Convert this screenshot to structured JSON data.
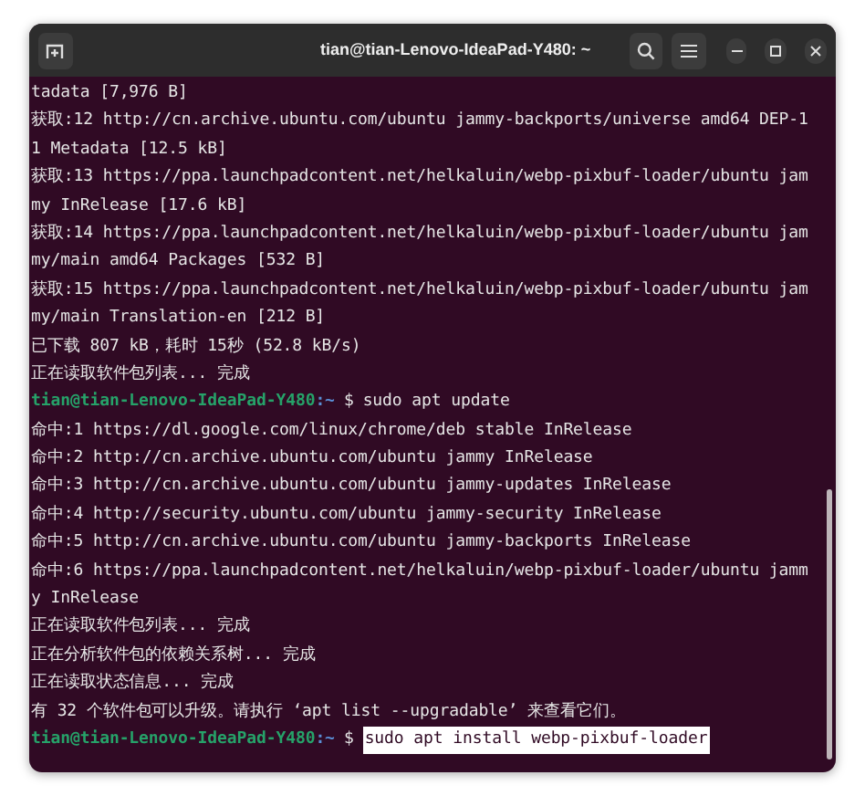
{
  "window": {
    "title": "tian@tian-Lenovo-IdeaPad-Y480: ~"
  },
  "lines": [
    {
      "kind": "output",
      "text": "tadata [7,976 B]"
    },
    {
      "kind": "output",
      "text": "获取:12 http://cn.archive.ubuntu.com/ubuntu jammy-backports/universe amd64 DEP-1"
    },
    {
      "kind": "output",
      "text": "1 Metadata [12.5 kB]"
    },
    {
      "kind": "output",
      "text": "获取:13 https://ppa.launchpadcontent.net/helkaluin/webp-pixbuf-loader/ubuntu jam"
    },
    {
      "kind": "output",
      "text": "my InRelease [17.6 kB]"
    },
    {
      "kind": "output",
      "text": "获取:14 https://ppa.launchpadcontent.net/helkaluin/webp-pixbuf-loader/ubuntu jam"
    },
    {
      "kind": "output",
      "text": "my/main amd64 Packages [532 B]"
    },
    {
      "kind": "output",
      "text": "获取:15 https://ppa.launchpadcontent.net/helkaluin/webp-pixbuf-loader/ubuntu jam"
    },
    {
      "kind": "output",
      "text": "my/main Translation-en [212 B]"
    },
    {
      "kind": "output",
      "text": "已下载 807 kB，耗时 15秒 (52.8 kB/s)"
    },
    {
      "kind": "output",
      "text": "正在读取软件包列表... 完成"
    },
    {
      "kind": "prompt",
      "user": "tian@tian-Lenovo-IdeaPad-Y480",
      "path": ":~",
      "symbol": "$",
      "command": "sudo apt update",
      "selected": false
    },
    {
      "kind": "output",
      "text": "命中:1 https://dl.google.com/linux/chrome/deb stable InRelease"
    },
    {
      "kind": "output",
      "text": "命中:2 http://cn.archive.ubuntu.com/ubuntu jammy InRelease"
    },
    {
      "kind": "output",
      "text": "命中:3 http://cn.archive.ubuntu.com/ubuntu jammy-updates InRelease"
    },
    {
      "kind": "output",
      "text": "命中:4 http://security.ubuntu.com/ubuntu jammy-security InRelease"
    },
    {
      "kind": "output",
      "text": "命中:5 http://cn.archive.ubuntu.com/ubuntu jammy-backports InRelease"
    },
    {
      "kind": "output",
      "text": "命中:6 https://ppa.launchpadcontent.net/helkaluin/webp-pixbuf-loader/ubuntu jamm"
    },
    {
      "kind": "output",
      "text": "y InRelease"
    },
    {
      "kind": "output",
      "text": "正在读取软件包列表... 完成"
    },
    {
      "kind": "output",
      "text": "正在分析软件包的依赖关系树... 完成"
    },
    {
      "kind": "output",
      "text": "正在读取状态信息... 完成"
    },
    {
      "kind": "output",
      "text": "有 32 个软件包可以升级。请执行 ‘apt list --upgradable’ 来查看它们。"
    },
    {
      "kind": "prompt",
      "user": "tian@tian-Lenovo-IdeaPad-Y480",
      "path": ":~",
      "symbol": "$",
      "command": "sudo apt install webp-pixbuf-loader",
      "selected": true
    }
  ]
}
